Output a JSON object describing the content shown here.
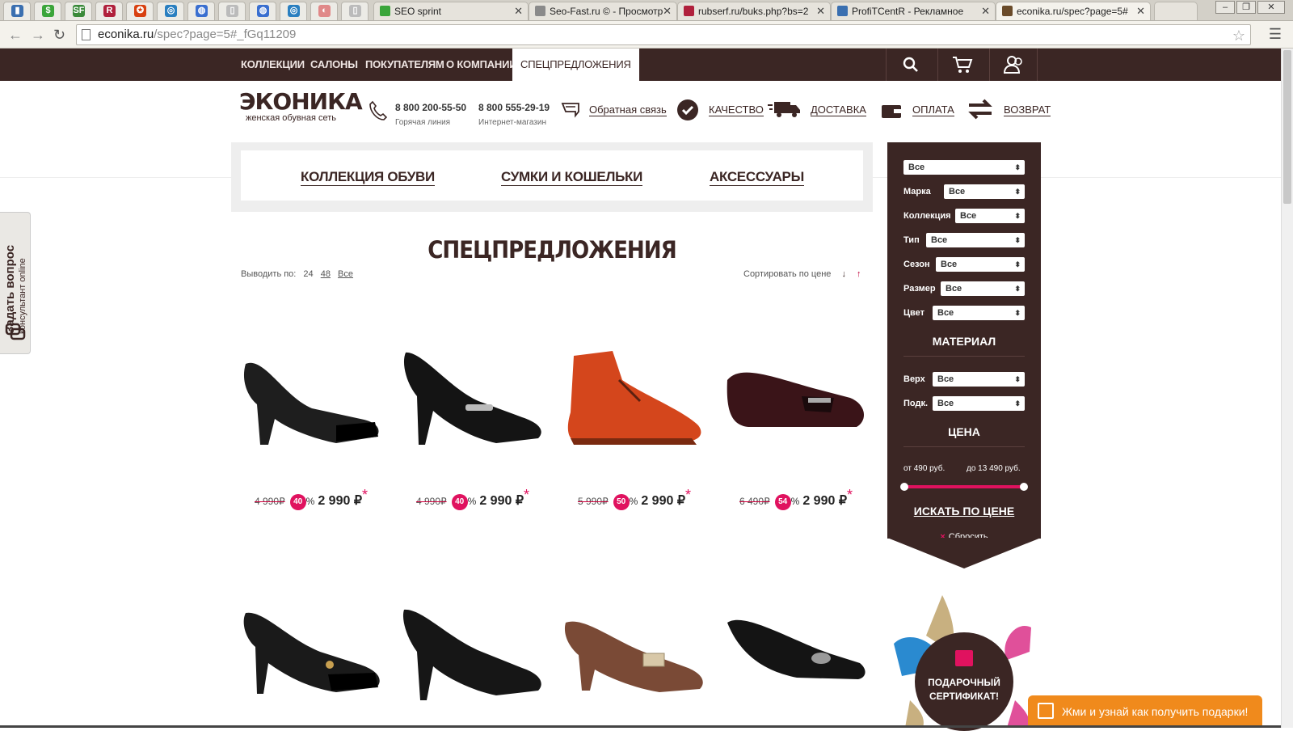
{
  "browser": {
    "tabs": [
      {
        "label": "SEO sprint",
        "fav_color": "#3aa53a"
      },
      {
        "label": "Seo-Fast.ru © - Просмотр",
        "fav_color": "#8a8a8a"
      },
      {
        "label": "rubserf.ru/buks.php?bs=2",
        "fav_color": "#b0203c"
      },
      {
        "label": "ProfiTCentR - Рекламное",
        "fav_color": "#3a6fb0"
      },
      {
        "label": "econika.ru/spec?page=5#",
        "fav_color": "#6a4b2a"
      }
    ],
    "url_host": "econika.ru",
    "url_rest": "/spec?page=5#_fGq11209"
  },
  "topnav": {
    "items": [
      "КОЛЛЕКЦИИ",
      "САЛОНЫ",
      "ПОКУПАТЕЛЯМ",
      "О КОМПАНИИ",
      "СПЕЦПРЕДЛОЖЕНИЯ"
    ],
    "icons": [
      "search-icon",
      "cart-icon",
      "account-icon"
    ]
  },
  "header": {
    "logo_main": "ЭКОНИКА",
    "logo_sub": "женская обувная сеть",
    "phone1": "8 800 200-55-50",
    "phone1_note": "Горячая линия",
    "phone2": "8 800 555-29-19",
    "phone2_note": "Интернет-магазин",
    "feedback": "Обратная связь",
    "links": [
      "КАЧЕСТВО",
      "ДОСТАВКА",
      "ОПЛАТА",
      "ВОЗВРАТ"
    ]
  },
  "categories": [
    "КОЛЛЕКЦИЯ ОБУВИ",
    "СУМКИ И КОШЕЛЬКИ",
    "АКСЕССУАРЫ"
  ],
  "page_title": "СПЕЦПРЕДЛОЖЕНИЯ",
  "listing": {
    "per_page_label": "Выводить по:",
    "per_page_options": [
      "24",
      "48",
      "Все"
    ],
    "sort_label": "Сортировать по цене",
    "sort_down": "↓",
    "sort_up": "↑"
  },
  "products": [
    {
      "old": "4 990₽",
      "disc": "40",
      "pct": "%",
      "price": "2 990 ₽",
      "mark": "*",
      "color": "#1e1e1e"
    },
    {
      "old": "4 990₽",
      "disc": "40",
      "pct": "%",
      "price": "2 990 ₽",
      "mark": "*",
      "color": "#141414"
    },
    {
      "old": "5 990₽",
      "disc": "50",
      "pct": "%",
      "price": "2 990 ₽",
      "mark": "*",
      "color": "#d4461c"
    },
    {
      "old": "6 490₽",
      "disc": "54",
      "pct": "%",
      "price": "2 990 ₽",
      "mark": "*",
      "color": "#3a1418"
    },
    {
      "color": "#1a1a1a"
    },
    {
      "color": "#161616"
    },
    {
      "color": "#7a4a36"
    },
    {
      "color": "#141414"
    }
  ],
  "filter": {
    "top_value": "Все",
    "fields": [
      {
        "label": "Марка",
        "value": "Все"
      },
      {
        "label": "Коллекция",
        "value": "Все"
      },
      {
        "label": "Тип",
        "value": "Все"
      },
      {
        "label": "Сезон",
        "value": "Все"
      },
      {
        "label": "Размер",
        "value": "Все"
      },
      {
        "label": "Цвет",
        "value": "Все"
      }
    ],
    "material_title": "МАТЕРИАЛ",
    "material_fields": [
      {
        "label": "Верх",
        "value": "Все"
      },
      {
        "label": "Подк.",
        "value": "Все"
      }
    ],
    "price_title": "ЦЕНА",
    "price_from": "от 490 руб.",
    "price_to": "до 13 490 руб.",
    "search_button": "ИСКАТЬ ПО ЦЕНЕ",
    "reset": "Сбросить",
    "reset_icon": "×"
  },
  "ask_widget": {
    "title": "Задать вопрос",
    "subtitle": "консультант online"
  },
  "gift": {
    "line1": "ПОДАРОЧНЫЙ",
    "line2": "СЕРТИФИКАТ!"
  },
  "promo_button": "Жми и узнай как получить подарки!",
  "colors": {
    "brand_brown": "#3b2624",
    "accent_pink": "#e0125f",
    "promo_orange": "#f08a1c"
  }
}
